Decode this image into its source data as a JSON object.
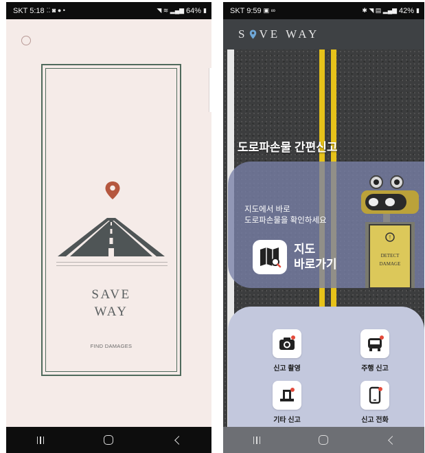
{
  "left_screen": {
    "status_bar": {
      "carrier_time": "SKT 5:18",
      "battery": "64%"
    },
    "logo": {
      "line1": "SAVE",
      "line2": "WAY"
    },
    "tagline": "FIND DAMAGES"
  },
  "right_screen": {
    "status_bar": {
      "carrier_time": "SKT 9:59",
      "battery": "42%"
    },
    "header": {
      "logo_before": "S",
      "logo_after": "VE WAY"
    },
    "title": "도로파손물 간편신고",
    "map_panel": {
      "desc_line1": "지도에서 바로",
      "desc_line2": "도로파손물을 확인하세요",
      "button_line1": "지도",
      "button_line2": "바로가기"
    },
    "robot_sign": {
      "line1": "DETECT",
      "line2": "DAMAGE"
    },
    "report_buttons": [
      {
        "label": "신고 촬영",
        "icon": "camera-icon"
      },
      {
        "label": "주행 신고",
        "icon": "car-icon"
      },
      {
        "label": "기타 신고",
        "icon": "barrier-icon"
      },
      {
        "label": "신고 전화",
        "icon": "phone-icon"
      }
    ]
  },
  "colors": {
    "left_background": "#f5ebe8",
    "frame": "#4f6a5c",
    "pin": "#b5573f",
    "panel_blue": "#7880a8",
    "report_panel": "#c3c8dd",
    "road_yellow": "#e6c21a",
    "alert_red": "#e24a3b"
  }
}
